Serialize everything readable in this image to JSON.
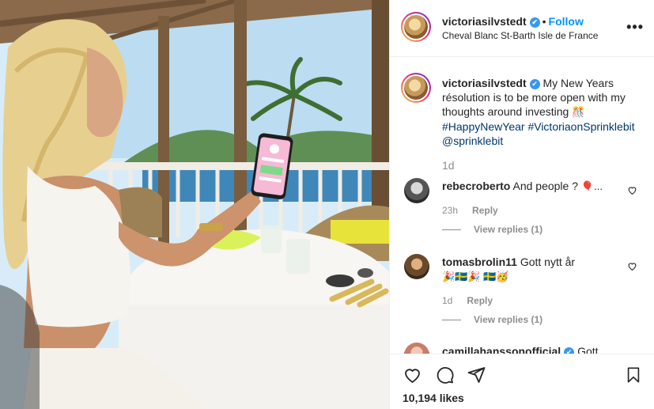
{
  "post": {
    "username": "victoriasilvstedt",
    "verified_mark": "✔",
    "separator": "•",
    "follow_label": "Follow",
    "location": "Cheval Blanc St-Barth Isle de France",
    "more_label": "•••",
    "caption": {
      "text": "My New Years résolution is to be more open with my thoughts around investing",
      "emoji": "🎊",
      "hashtags": [
        "#HappyNewYear",
        "#VictoriaonSprinklebit"
      ],
      "mention": "@sprinklebit",
      "time": "1d"
    },
    "comments": [
      {
        "username": "rebecroberto",
        "text": "And people ?",
        "emoji": "🎈...",
        "time": "23h",
        "reply_label": "Reply",
        "view_replies": "View replies (1)"
      },
      {
        "username": "tomasbrolin11",
        "text": "Gott nytt år",
        "emoji": "🎉🇸🇪🎉 🇸🇪🥳",
        "time": "1d",
        "reply_label": "Reply",
        "view_replies": "View replies (1)"
      },
      {
        "username": "camillahanssonofficial",
        "text": "Gott",
        "verified": true
      }
    ],
    "likes": "10,194 likes"
  },
  "icons": {
    "like": "heart-icon",
    "comment": "comment-icon",
    "share": "share-icon",
    "save": "bookmark-icon",
    "comment_like": "heart-icon"
  },
  "colors": {
    "link_blue": "#0095f6",
    "hashtag": "#00376b",
    "muted": "#8e8e8e",
    "verified": "#3897f0"
  }
}
